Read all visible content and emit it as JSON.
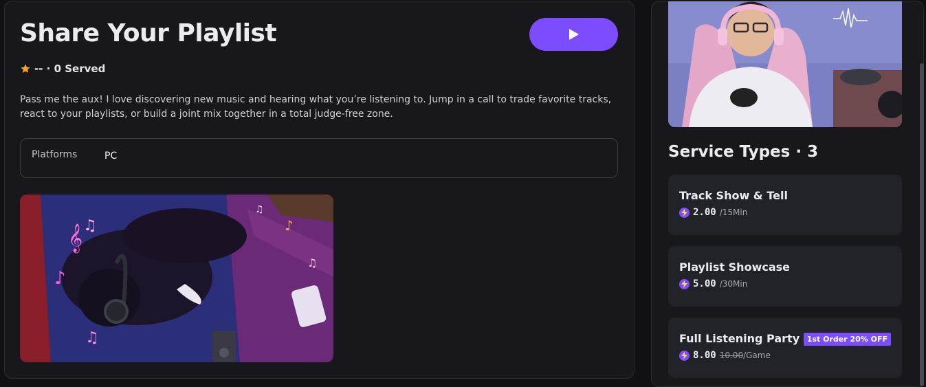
{
  "listing": {
    "title": "Share Your Playlist",
    "rating": "-- · 0 Served",
    "description": "Pass me the aux! I love discovering new music and hearing what you’re listening to. Jump in a call to trade favorite tracks, react to your playlists, or build a joint mix together in a total judge-free zone.",
    "platforms_label": "Platforms",
    "platforms_value": "PC"
  },
  "services_section": {
    "title": "Service Types · 3",
    "items": [
      {
        "name": "Track Show & Tell",
        "price": "2.00",
        "unit": "/15Min"
      },
      {
        "name": "Playlist Showcase",
        "price": "5.00",
        "unit": "/30Min"
      },
      {
        "name": "Full Listening Party",
        "price": "8.00",
        "old_price": "10.00",
        "unit": "/Game",
        "badge": "1st Order 20% OFF"
      }
    ]
  },
  "colors": {
    "accent": "#7c4dff",
    "star": "#f5a623",
    "background": "#111114",
    "card": "#18181c"
  },
  "icons": [
    "play-icon",
    "star-icon",
    "bolt-icon"
  ]
}
